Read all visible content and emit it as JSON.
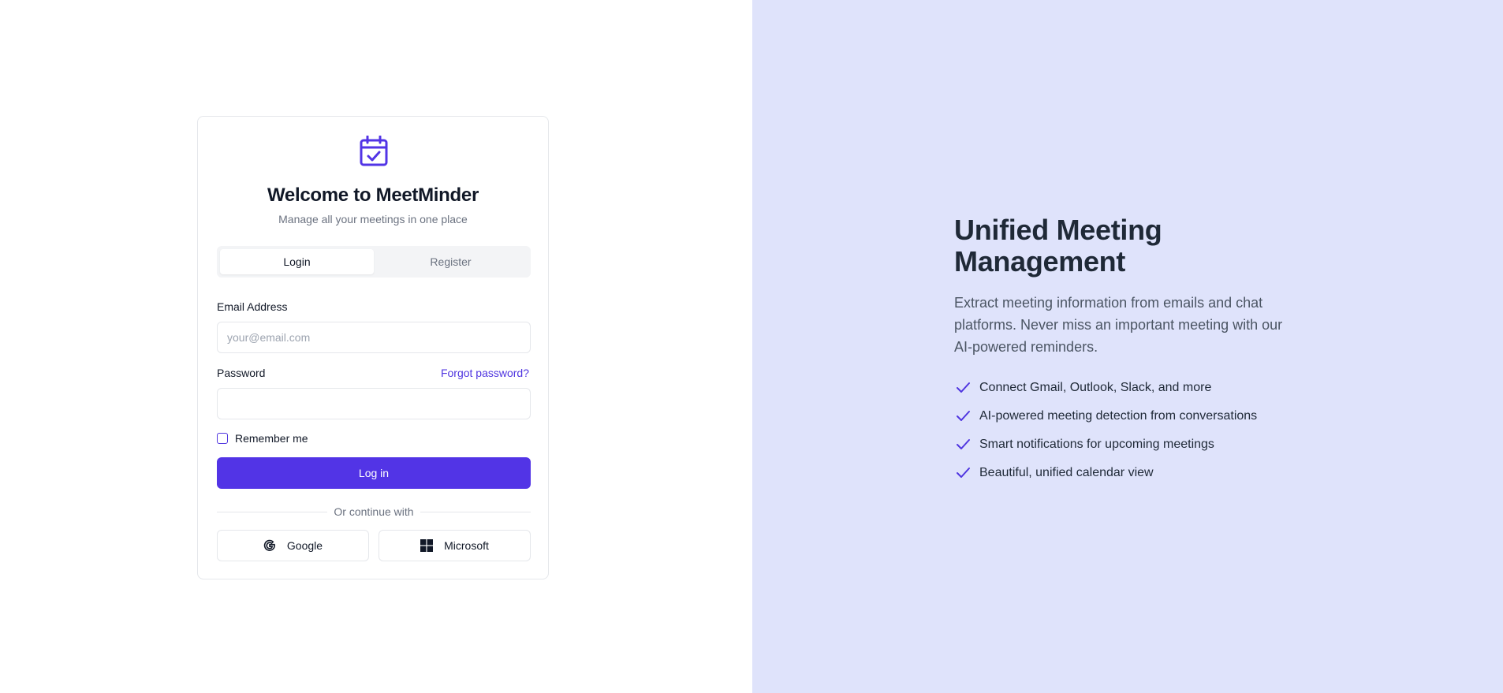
{
  "login_card": {
    "title": "Welcome to MeetMinder",
    "subtitle": "Manage all your meetings in one place",
    "tabs": [
      {
        "label": "Login",
        "active": true
      },
      {
        "label": "Register",
        "active": false
      }
    ],
    "email": {
      "label": "Email Address",
      "placeholder": "your@email.com",
      "value": ""
    },
    "password": {
      "label": "Password",
      "forgot_label": "Forgot password?",
      "value": ""
    },
    "remember_label": "Remember me",
    "remember_checked": false,
    "submit_label": "Log in",
    "divider_text": "Or continue with",
    "oauth": {
      "google_label": "Google",
      "microsoft_label": "Microsoft"
    }
  },
  "hero": {
    "title": "Unified Meeting Management",
    "description": "Extract meeting information from emails and chat platforms. Never miss an important meeting with our AI-powered reminders.",
    "features": [
      "Connect Gmail, Outlook, Slack, and more",
      "AI-powered meeting detection from conversations",
      "Smart notifications for upcoming meetings",
      "Beautiful, unified calendar view"
    ]
  },
  "colors": {
    "accent": "#5234e6",
    "hero_background": "#dfe3fb",
    "card_border": "#e5e7eb"
  },
  "icons": {
    "logo": "calendar-check-icon",
    "google": "google-icon",
    "microsoft": "microsoft-icon",
    "feature": "checkmark-icon"
  }
}
